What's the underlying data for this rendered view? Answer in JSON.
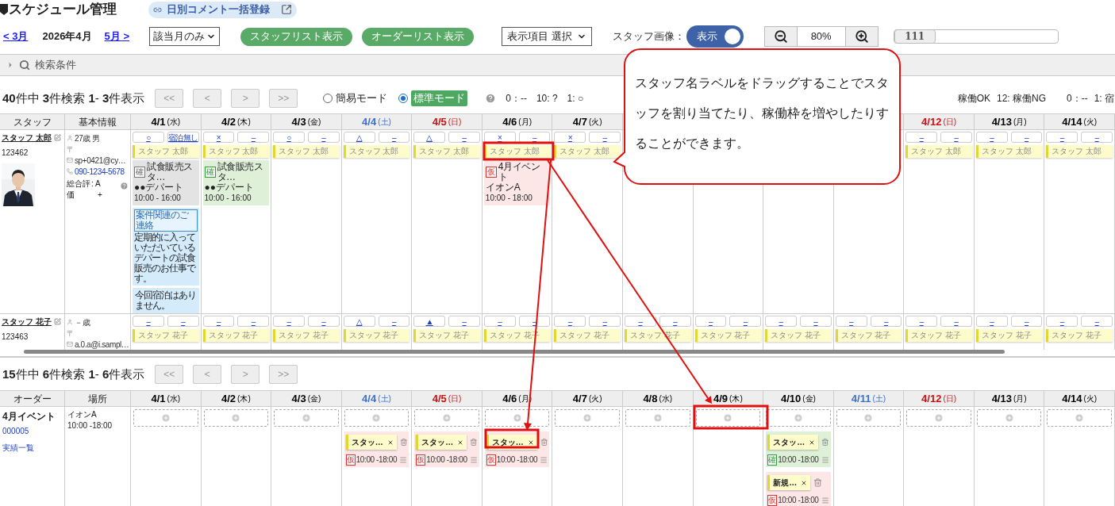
{
  "header": {
    "title": "スケジュール管理",
    "comment_button": "日別コメント一括登録"
  },
  "controls": {
    "prev_month": "< 3月",
    "current_month": "2026年4月",
    "next_month": "5月 >",
    "range_select": "該当月のみ",
    "buttons": [
      "スタッフリスト表示",
      "オーダーリスト表示"
    ],
    "display_select": "表示項目 選択",
    "image_label": "スタッフ画像：",
    "image_toggle": {
      "label": "表示",
      "on": true
    },
    "zoom": "80%",
    "slider": {
      "label": "111",
      "level": 0
    }
  },
  "search": {
    "label": "検索条件",
    "expanded": false
  },
  "staff_pager": {
    "summary": "**40**件中 **3**件検索 **1**- **3**件表示",
    "buttons": [
      "<<",
      "<",
      ">",
      ">>"
    ]
  },
  "modes": [
    {
      "label": "簡易モード",
      "selected": false
    },
    {
      "label": "標準モード",
      "selected": true
    }
  ],
  "legend_left": [
    "0：--",
    "10: ?",
    "1: ○"
  ],
  "legend_right": [
    "稼働OK",
    "12: 稼働NG",
    "0：--",
    "1: 宿"
  ],
  "staff_table": {
    "columns": [
      "スタッフ",
      "基本情報"
    ],
    "days": [
      {
        "date": "4/1",
        "weekday": "(水)",
        "kind": "weekday"
      },
      {
        "date": "4/2",
        "weekday": "(木)",
        "kind": "weekday"
      },
      {
        "date": "4/3",
        "weekday": "(金)",
        "kind": "weekday"
      },
      {
        "date": "4/4",
        "weekday": "(土)",
        "kind": "saturday"
      },
      {
        "date": "4/5",
        "weekday": "(日)",
        "kind": "sunday"
      },
      {
        "date": "4/6",
        "weekday": "(月)",
        "kind": "weekday"
      },
      {
        "date": "4/7",
        "weekday": "(火)",
        "kind": "weekday"
      },
      {
        "kind": "hidden"
      },
      {
        "kind": "hidden"
      },
      {
        "kind": "hidden"
      },
      {
        "kind": "hidden"
      },
      {
        "date": "4/12",
        "weekday": "(日)",
        "kind": "sunday"
      },
      {
        "date": "4/13",
        "weekday": "(月)",
        "kind": "weekday"
      },
      {
        "date": "4/14",
        "weekday": "(火)",
        "kind": "weekday"
      }
    ],
    "rows": [
      {
        "name": "スタッフ 太郎",
        "id": "123462",
        "photo": true,
        "info": [
          {
            "kind": "person",
            "text": "27歳 男"
          },
          {
            "kind": "postal",
            "text": "〒"
          },
          {
            "kind": "mail",
            "text": "sp+0421@cy…"
          },
          {
            "kind": "phone",
            "text": "090-1234-5678"
          }
        ],
        "rating_label": "総合評価",
        "rating": ": A",
        "rating_sub": "+",
        "cells": [
          {
            "marks": [
              "○",
              "宿泊無し"
            ],
            "label": "スタッフ 太郎",
            "entries": [
              {
                "kind": "job",
                "color": "#e3e3e3",
                "badge": "確",
                "title": "試食販売スタ…",
                "place": "●●デパート",
                "time": "10:00 - 16:00"
              },
              {
                "kind": "comment",
                "tag": "案件関連のご連絡",
                "text": "定期的に入っていただいているデパートの試食販売のお仕事です。"
              },
              {
                "kind": "note",
                "text": "今回宿泊はありません。"
              }
            ]
          },
          {
            "marks": [
              "×",
              "–"
            ],
            "label": "スタッフ 太郎",
            "entries": [
              {
                "kind": "job",
                "color": "#dff0d8",
                "badge": "確",
                "title": "試食販売スタ…",
                "place": "●●デパート",
                "time": "10:00 - 16:00"
              }
            ]
          },
          {
            "marks": [
              "○",
              "–"
            ],
            "label": "スタッフ 太郎"
          },
          {
            "marks": [
              "△",
              "–"
            ],
            "label": "スタッフ 太郎"
          },
          {
            "marks": [
              "△",
              "–"
            ],
            "label": "スタッフ 太郎"
          },
          {
            "marks": [
              "×",
              "–"
            ],
            "label": "スタッフ 太郎",
            "entries": [
              {
                "kind": "job",
                "color": "#fde6e6",
                "badge": "仮",
                "title": "4月イベント",
                "place": "イオンA",
                "time": "10:00 - 18:00"
              }
            ]
          },
          {
            "marks": [
              "×",
              "–"
            ],
            "label": "スタッフ 太郎"
          },
          {
            "kind": "hidden"
          },
          {
            "kind": "hidden"
          },
          {
            "kind": "hidden"
          },
          {
            "kind": "hidden"
          },
          {
            "marks": [
              "–",
              "–"
            ],
            "label": "スタッフ 太郎"
          },
          {
            "marks": [
              "–",
              "–"
            ],
            "label": "スタッフ 太郎"
          },
          {
            "marks": [
              "–",
              "–"
            ],
            "label": "スタッフ 太郎"
          }
        ]
      },
      {
        "name": "スタッフ 花子",
        "id": "123463",
        "info": [
          {
            "kind": "person",
            "text": "－歳"
          },
          {
            "kind": "postal",
            "text": "〒"
          },
          {
            "kind": "mail",
            "text": "a.0.a@i.sampl…"
          }
        ],
        "cells": [
          {
            "marks": [
              "–",
              "–"
            ],
            "label": "スタッフ 花子"
          },
          {
            "marks": [
              "–",
              "–"
            ],
            "label": "スタッフ 花子"
          },
          {
            "marks": [
              "–",
              "–"
            ],
            "label": "スタッフ 花子"
          },
          {
            "marks": [
              "△",
              "–"
            ],
            "label": "スタッフ 花子"
          },
          {
            "marks": [
              "▲",
              "–"
            ],
            "label": "スタッフ 花子"
          },
          {
            "marks": [
              "–",
              "–"
            ],
            "label": "スタッフ 花子"
          },
          {
            "marks": [
              "–",
              "–"
            ],
            "label": "スタッフ 花子"
          },
          {
            "marks": [
              "–",
              "–"
            ],
            "label": "スタッフ 花子"
          },
          {
            "marks": [
              "–",
              "–"
            ],
            "label": "スタッフ 花子"
          },
          {
            "marks": [
              "–",
              "–"
            ],
            "label": "スタッフ 花子"
          },
          {
            "marks": [
              "–",
              "–"
            ],
            "label": "スタッフ 花子"
          },
          {
            "marks": [
              "–",
              "–"
            ],
            "label": "スタッフ 花子"
          },
          {
            "marks": [
              "–",
              "–"
            ],
            "label": "スタッフ 花子"
          },
          {
            "marks": [
              "–",
              "–"
            ],
            "label": "スタッフ 花子"
          }
        ]
      }
    ]
  },
  "order_pager": {
    "summary": "**15**件中 **6**件検索 **1**- **6**件表示",
    "buttons": [
      "<<",
      "<",
      ">",
      ">>"
    ]
  },
  "order_table": {
    "columns": [
      "オーダー",
      "場所"
    ],
    "days": [
      {
        "date": "4/1",
        "weekday": "(水)",
        "kind": "weekday"
      },
      {
        "date": "4/2",
        "weekday": "(木)",
        "kind": "weekday"
      },
      {
        "date": "4/3",
        "weekday": "(金)",
        "kind": "weekday"
      },
      {
        "date": "4/4",
        "weekday": "(土)",
        "kind": "saturday"
      },
      {
        "date": "4/5",
        "weekday": "(日)",
        "kind": "sunday"
      },
      {
        "date": "4/6",
        "weekday": "(月)",
        "kind": "weekday"
      },
      {
        "date": "4/7",
        "weekday": "(火)",
        "kind": "weekday"
      },
      {
        "date": "4/8",
        "weekday": "(水)",
        "kind": "weekday"
      },
      {
        "date": "4/9",
        "weekday": "(木)",
        "kind": "weekday"
      },
      {
        "date": "4/10",
        "weekday": "(金)",
        "kind": "weekday"
      },
      {
        "date": "4/11",
        "weekday": "(土)",
        "kind": "saturday"
      },
      {
        "date": "4/12",
        "weekday": "(日)",
        "kind": "sunday"
      },
      {
        "date": "4/13",
        "weekday": "(月)",
        "kind": "weekday"
      },
      {
        "date": "4/14",
        "weekday": "(火)",
        "kind": "weekday"
      }
    ],
    "rows": [
      {
        "name": "4月イベント",
        "code": "000005",
        "link": "実績一覧",
        "place": "イオンA",
        "time": "10:00 -18:00",
        "cells": [
          {},
          {},
          {},
          {
            "assignments": [
              {
                "name": "スタッ…",
                "color": "#fde6e6",
                "badge": "仮",
                "time": "10:00 -18:00"
              }
            ]
          },
          {
            "assignments": [
              {
                "name": "スタッ…",
                "color": "#fde6e6",
                "badge": "仮",
                "time": "10:00 -18:00"
              }
            ]
          },
          {
            "assignments": [
              {
                "name": "スタッ…",
                "color": "#fde6e6",
                "badge": "仮",
                "time": "10:00 -18:00"
              }
            ]
          },
          {},
          {},
          {},
          {
            "assignments": [
              {
                "name": "スタッ…",
                "color": "#dff0d8",
                "badge": "確",
                "time": "10:00 -18:00"
              },
              {
                "name": "新規…",
                "color": "#fde6e6",
                "badge": "仮",
                "time": "10:00 -18:00"
              }
            ]
          },
          {},
          {},
          {},
          {}
        ]
      }
    ]
  },
  "callout": "スタッフ名ラベルをドラッグすることでスタッフを割り当てたり、稼働枠を増やしたりすることができます。"
}
